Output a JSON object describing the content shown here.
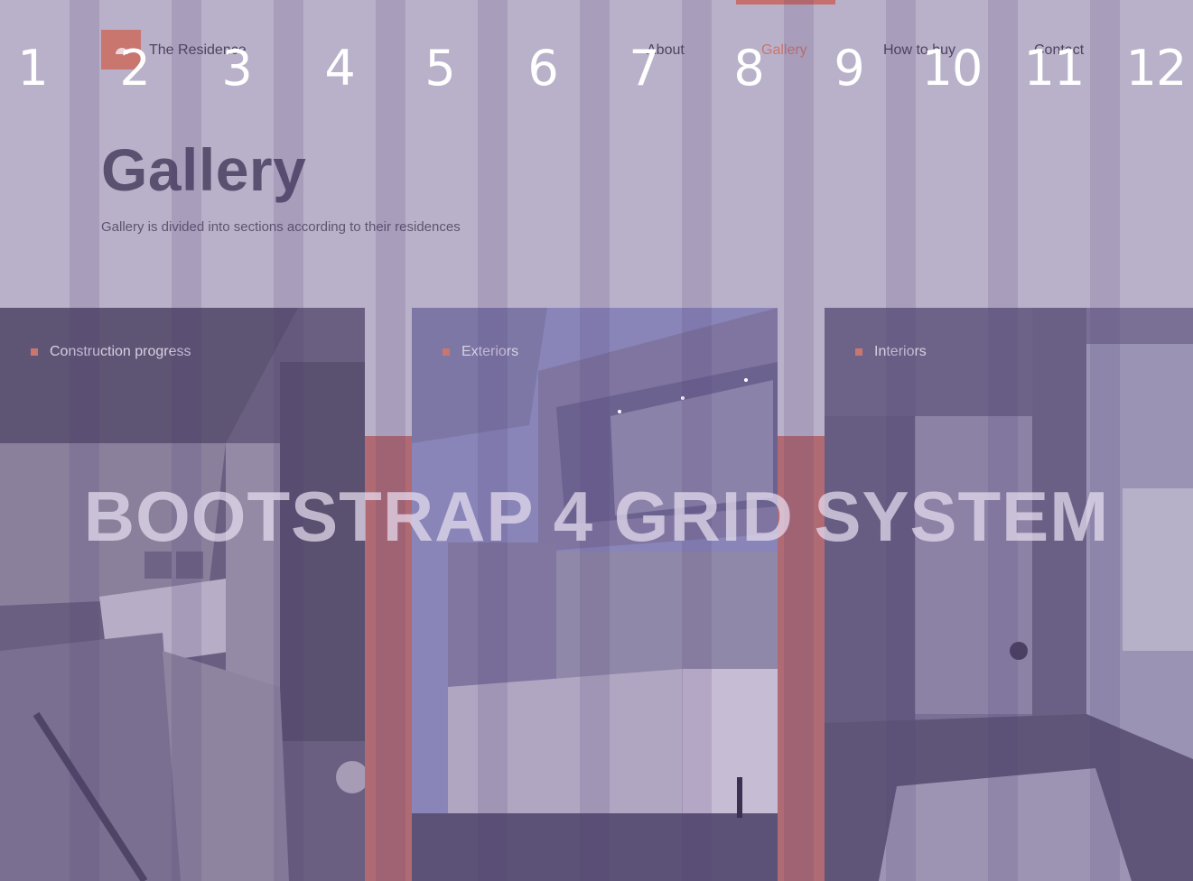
{
  "header": {
    "brand": "The Residence",
    "nav": [
      {
        "label": "About",
        "active": false
      },
      {
        "label": "Gallery",
        "active": true
      },
      {
        "label": "How to buy",
        "active": false
      },
      {
        "label": "Contact",
        "active": false
      }
    ]
  },
  "hero": {
    "title": "Gallery",
    "subtitle": "Gallery is divided into sections according to their residences"
  },
  "cards": [
    {
      "label": "Construction progress"
    },
    {
      "label": "Exteriors"
    },
    {
      "label": "Interiors"
    }
  ],
  "overlay": {
    "title": "BOOTSTRAP 4 GRID SYSTEM",
    "columns": [
      "1",
      "2",
      "3",
      "4",
      "5",
      "6",
      "7",
      "8",
      "9",
      "10",
      "11",
      "12"
    ]
  },
  "colors": {
    "accent": "#c9766f",
    "background": "#b9b1c9",
    "gutter": "#b06a74",
    "text_dark": "#4c4360"
  }
}
